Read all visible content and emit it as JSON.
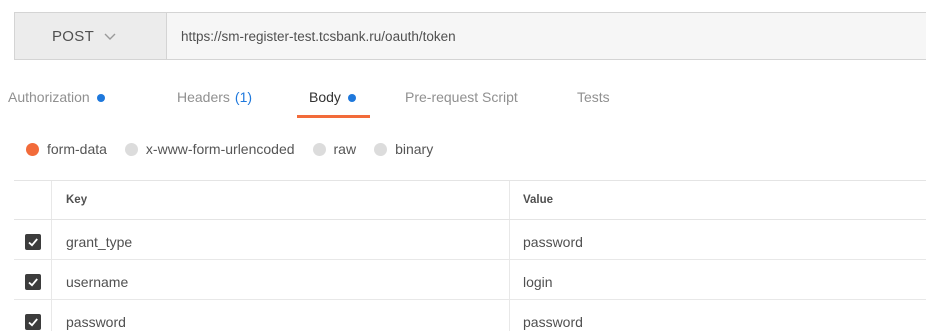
{
  "request": {
    "method": "POST",
    "url": "https://sm-register-test.tcsbank.ru/oauth/token"
  },
  "tabs": [
    {
      "label": "Authorization",
      "dot": true,
      "active": false
    },
    {
      "label": "Headers",
      "count": "(1)",
      "active": false
    },
    {
      "label": "Body",
      "dot": true,
      "active": true
    },
    {
      "label": "Pre-request Script",
      "active": false
    },
    {
      "label": "Tests",
      "active": false
    }
  ],
  "body_types": [
    {
      "label": "form-data",
      "selected": true
    },
    {
      "label": "x-www-form-urlencoded",
      "selected": false
    },
    {
      "label": "raw",
      "selected": false
    },
    {
      "label": "binary",
      "selected": false
    }
  ],
  "table": {
    "headers": {
      "key": "Key",
      "value": "Value"
    },
    "rows": [
      {
        "key": "grant_type",
        "value": "password",
        "checked": true
      },
      {
        "key": "username",
        "value": "login",
        "checked": true
      },
      {
        "key": "password",
        "value": "password",
        "checked": true
      }
    ]
  },
  "colors": {
    "accent": "#f26b3a",
    "dot": "#1e78dc",
    "checkbox": "#3c3c3c"
  },
  "icons": {
    "method_dropdown": "chevron-down-icon",
    "checkbox": "check-icon"
  }
}
